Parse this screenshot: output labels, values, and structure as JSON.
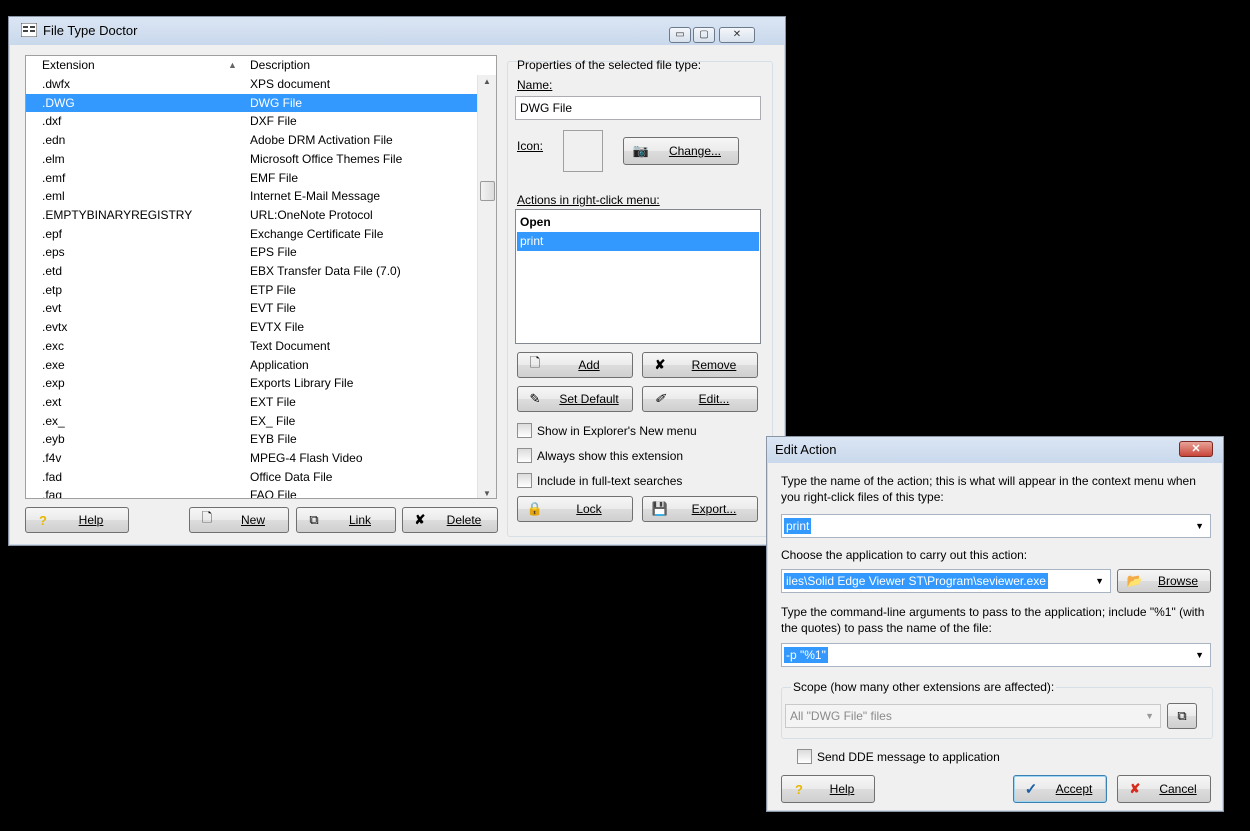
{
  "main": {
    "title": "File Type Doctor",
    "controls": [
      "▭",
      "▢",
      "✕"
    ],
    "columns": {
      "extension": "Extension",
      "description": "Description",
      "sort_arrow": "▲"
    },
    "rows": [
      {
        "ext": ".dwfx",
        "desc": "XPS document"
      },
      {
        "ext": ".DWG",
        "desc": "DWG File",
        "selected": true
      },
      {
        "ext": ".dxf",
        "desc": "DXF File"
      },
      {
        "ext": ".edn",
        "desc": "Adobe DRM Activation File"
      },
      {
        "ext": ".elm",
        "desc": "Microsoft Office Themes File"
      },
      {
        "ext": ".emf",
        "desc": "EMF File"
      },
      {
        "ext": ".eml",
        "desc": "Internet E-Mail Message"
      },
      {
        "ext": ".EMPTYBINARYREGISTRY",
        "desc": "URL:OneNote Protocol"
      },
      {
        "ext": ".epf",
        "desc": "Exchange Certificate File"
      },
      {
        "ext": ".eps",
        "desc": "EPS File"
      },
      {
        "ext": ".etd",
        "desc": "EBX Transfer Data File (7.0)"
      },
      {
        "ext": ".etp",
        "desc": "ETP File"
      },
      {
        "ext": ".evt",
        "desc": "EVT File"
      },
      {
        "ext": ".evtx",
        "desc": "EVTX File"
      },
      {
        "ext": ".exc",
        "desc": "Text Document"
      },
      {
        "ext": ".exe",
        "desc": "Application"
      },
      {
        "ext": ".exp",
        "desc": "Exports Library File"
      },
      {
        "ext": ".ext",
        "desc": "EXT File"
      },
      {
        "ext": ".ex_",
        "desc": "EX_ File"
      },
      {
        "ext": ".eyb",
        "desc": "EYB File"
      },
      {
        "ext": ".f4v",
        "desc": "MPEG-4 Flash Video"
      },
      {
        "ext": ".fad",
        "desc": "Office Data File"
      },
      {
        "ext": ".faq",
        "desc": "FAQ File"
      }
    ],
    "buttons": {
      "help": "Help",
      "new": "New",
      "link": "Link",
      "delete": "Delete"
    },
    "props": {
      "group_title": "Properties of the selected file type:",
      "name_label": "Name:",
      "name_value": "DWG File",
      "icon_label": "Icon:",
      "change_button": "Change...",
      "actions_label": "Actions in right-click menu:",
      "actions": [
        {
          "label": "Open",
          "bold": true
        },
        {
          "label": "print",
          "selected": true
        }
      ],
      "add": "Add",
      "remove": "Remove",
      "set_default": "Set Default",
      "edit": "Edit...",
      "chk_new_menu": "Show in Explorer's New menu",
      "chk_always_show": "Always show this extension",
      "chk_fulltext": "Include in full-text searches",
      "lock": "Lock",
      "export": "Export..."
    }
  },
  "edit_action": {
    "title": "Edit Action",
    "close": "✕",
    "prompt_name": "Type the name of the action; this is what will appear in the context menu when you right-click files of this type:",
    "action_name": "print",
    "prompt_app": "Choose the application to carry out this action:",
    "app_path": "iles\\Solid Edge Viewer ST\\Program\\seviewer.exe",
    "browse": "Browse",
    "prompt_args": "Type the command-line arguments to pass to the application; include \"%1\" (with the quotes) to pass the name of the file:",
    "args": "-p \"%1\"",
    "scope_title": "Scope (how many other extensions are affected):",
    "scope_value": "All \"DWG File\" files",
    "dde_label": "Send DDE message to application",
    "help": "Help",
    "accept": "Accept",
    "cancel": "Cancel"
  },
  "colors": {
    "selection": "#3399ff",
    "desktop": "#000000",
    "title_gradient": "#dbe6f4",
    "close_red": "#c9453a"
  }
}
